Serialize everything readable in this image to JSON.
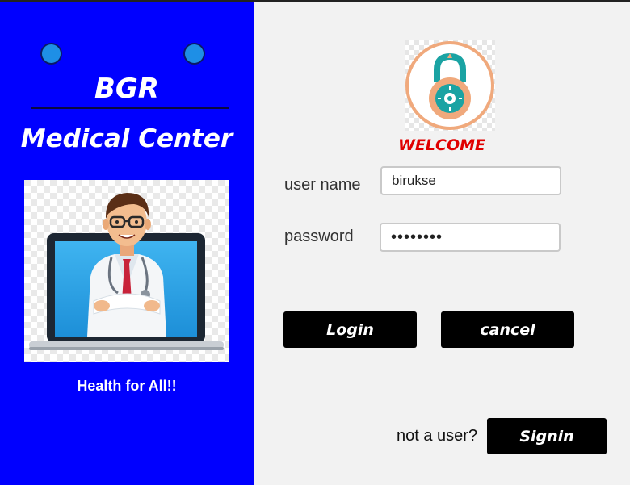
{
  "sidebar": {
    "brand_line1": "BGR",
    "brand_line2": "Medical Center",
    "tagline": "Health for All!!",
    "doctor_image_icon": "doctor-on-laptop-icon"
  },
  "login": {
    "lock_icon": "padlock-icon",
    "welcome": "WELCOME",
    "username_label": "user name",
    "username_value": "birukse",
    "password_label": "password",
    "password_value": "••••••••",
    "login_button": "Login",
    "cancel_button": "cancel",
    "not_user_text": "not a user?",
    "signin_button": "Signin"
  },
  "colors": {
    "sidebar_bg": "#0000ff",
    "main_bg": "#f2f2f2",
    "welcome": "#e00000",
    "button_bg": "#000000"
  }
}
